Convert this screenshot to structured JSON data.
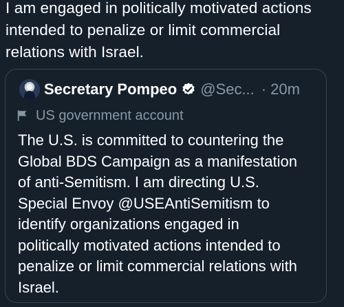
{
  "tweet": {
    "text": "I am engaged in politically motivated actions\nintended to penalize or limit commercial\nrelations with Israel."
  },
  "quoted_tweet": {
    "display_name": "Secretary Pompeo",
    "handle": "@Sec...",
    "separator": "·",
    "time": "20m",
    "label": "US government account",
    "text": "The U.S. is committed to countering the\nGlobal BDS Campaign as a manifestation\nof anti-Semitism. I am directing U.S.\nSpecial Envoy @USEAntiSemitism to\nidentify organizations engaged in\npolitically motivated actions intended to\npenalize or limit commercial relations with\nIsrael.",
    "icons": [
      "avatar",
      "verified-badge-icon",
      "flag-icon"
    ]
  },
  "colors": {
    "background": "#15202b",
    "text": "#ffffff",
    "secondary": "#8899a6",
    "border": "#38444d"
  }
}
